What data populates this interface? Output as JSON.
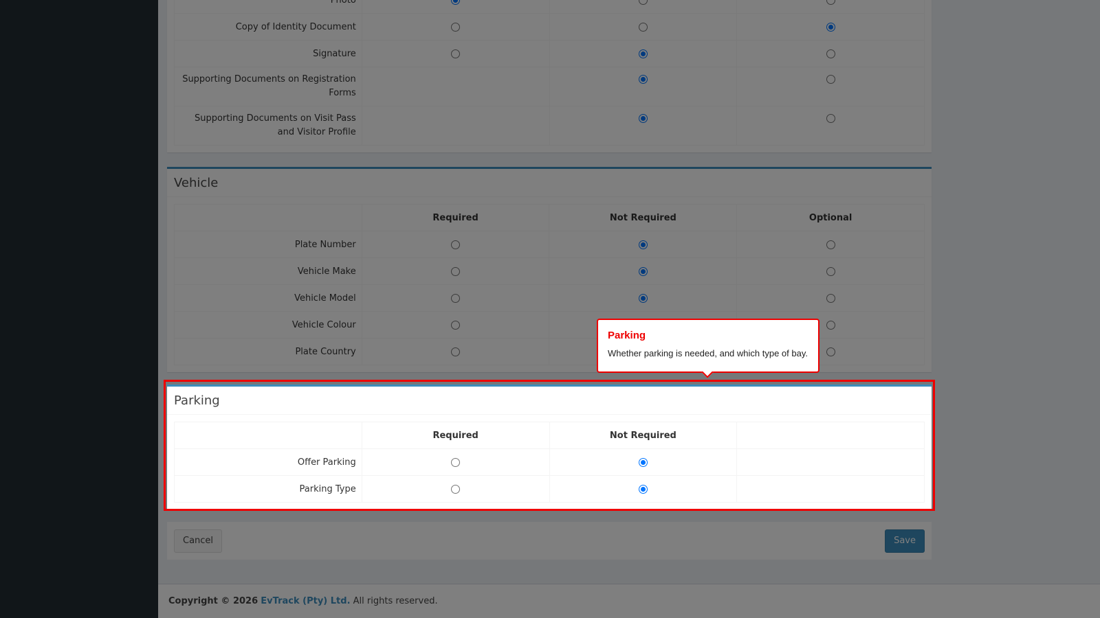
{
  "colors": {
    "accent": "#3c8dbc",
    "highlight": "#e00000",
    "radio": "#0075ff"
  },
  "icons": {
    "radio_selected": "radio-selected-icon",
    "radio_unselected": "radio-unselected-icon"
  },
  "documents": {
    "rows": [
      {
        "label": "Photo",
        "states": [
          "on",
          "off",
          "off"
        ]
      },
      {
        "label": "Copy of Identity Document",
        "states": [
          "off",
          "off",
          "on"
        ]
      },
      {
        "label": "Signature",
        "states": [
          "off",
          "on",
          "off"
        ]
      },
      {
        "label": "Supporting Documents on Registration Forms",
        "states": [
          "",
          "on",
          "off"
        ]
      },
      {
        "label": "Supporting Documents on Visit Pass and Visitor Profile",
        "states": [
          "",
          "on",
          "off"
        ]
      }
    ]
  },
  "vehicle": {
    "title": "Vehicle",
    "columns": [
      "Required",
      "Not Required",
      "Optional"
    ],
    "rows": [
      {
        "label": "Plate Number",
        "states": [
          "off",
          "on",
          "off"
        ]
      },
      {
        "label": "Vehicle Make",
        "states": [
          "off",
          "on",
          "off"
        ]
      },
      {
        "label": "Vehicle Model",
        "states": [
          "off",
          "on",
          "off"
        ]
      },
      {
        "label": "Vehicle Colour",
        "states": [
          "off",
          "on",
          "off"
        ]
      },
      {
        "label": "Plate Country",
        "states": [
          "off",
          "on",
          "off"
        ]
      }
    ]
  },
  "parking": {
    "title": "Parking",
    "columns": [
      "Required",
      "Not Required",
      ""
    ],
    "rows": [
      {
        "label": "Offer Parking",
        "states": [
          "off",
          "on",
          ""
        ]
      },
      {
        "label": "Parking Type",
        "states": [
          "off",
          "on",
          ""
        ]
      }
    ]
  },
  "actions": {
    "cancel_label": "Cancel",
    "save_label": "Save"
  },
  "footer": {
    "prefix": "Copyright © 2026",
    "company": "EvTrack (Pty) Ltd.",
    "suffix": "All rights reserved."
  },
  "tooltip": {
    "title": "Parking",
    "text": "Whether parking is needed, and which type of bay."
  }
}
